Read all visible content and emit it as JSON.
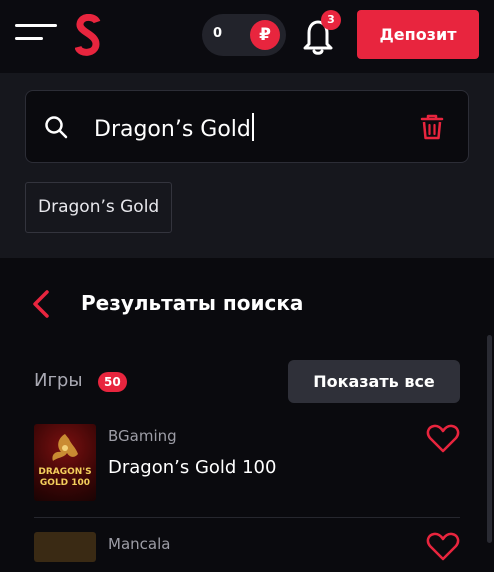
{
  "header": {
    "menu_icon": "hamburger-icon",
    "logo_letter": "S",
    "balance_amount": "0",
    "currency_symbol": "₽",
    "notification_count": "3",
    "deposit_label": "Депозит"
  },
  "search": {
    "query": "Dragon’s Gold",
    "suggestion_chip": "Dragon’s Gold"
  },
  "results": {
    "title": "Результаты поиска",
    "games_section_label": "Игры",
    "games_count": "50",
    "show_all_label": "Показать все",
    "items": [
      {
        "provider": "BGaming",
        "name": "Dragon’s Gold 100",
        "thumb_text": "DRAGON'S\nGOLD 100",
        "favorite": false
      },
      {
        "provider": "Mancala",
        "name": "",
        "favorite": false
      }
    ]
  },
  "colors": {
    "accent": "#e8253e",
    "background": "#0a0a0e",
    "panel": "#16171d",
    "button_secondary": "#2f3039"
  }
}
